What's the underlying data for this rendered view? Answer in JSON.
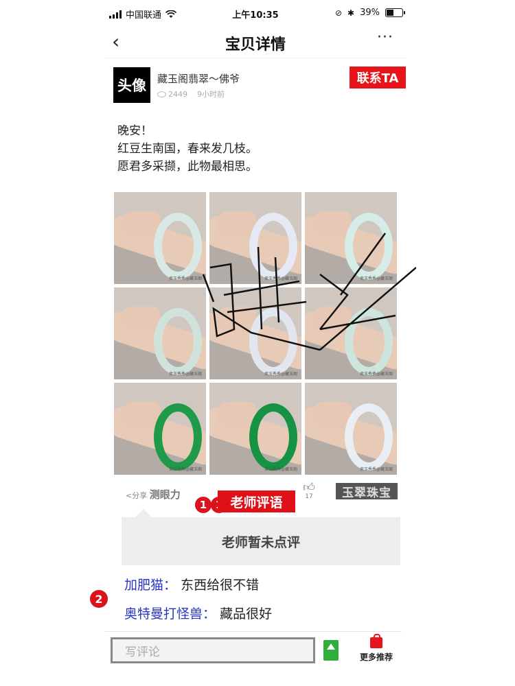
{
  "status": {
    "carrier": "中国联通",
    "time": "上午10:35",
    "battery": "39%"
  },
  "nav": {
    "back_icon": "‹",
    "title": "宝贝详情",
    "more_icon": "···"
  },
  "author": {
    "avatar_text": "头像",
    "name": "藏玉阁翡翠～佛爷",
    "views": "2449",
    "time_ago": "9小时前"
  },
  "contact_button": "联系TA",
  "post": {
    "lines": [
      "晚安！",
      "红豆生南国，春来发几枝。",
      "愿君多采撷，此物最相思。"
    ]
  },
  "photos": [
    {
      "watermark": "卖玉秀秀@藏玉阁",
      "bangle_color": "#d8e8e4"
    },
    {
      "watermark": "卖玉秀秀@藏玉阁",
      "bangle_color": "#e6e8f4"
    },
    {
      "watermark": "卖玉秀秀@藏玉阁",
      "bangle_color": "#d6ece6"
    },
    {
      "watermark": "卖玉秀秀@藏玉阁",
      "bangle_color": "#cfe3dc"
    },
    {
      "watermark": "卖玉秀秀@藏玉阁",
      "bangle_color": "#e1e6ef"
    },
    {
      "watermark": "卖玉秀秀@藏玉阁",
      "bangle_color": "#cde5dc"
    },
    {
      "watermark": "卖玉秀秀@藏玉阁",
      "bangle_color": "#1f9a4a"
    },
    {
      "watermark": "卖玉秀秀@藏玉阁",
      "bangle_color": "#159243"
    },
    {
      "watermark": "卖玉秀秀@藏玉阁",
      "bangle_color": "#e9eef4"
    }
  ],
  "actions": {
    "share_label": "分享",
    "test_label": "测眼力",
    "badge1": "1",
    "teacher_label": "老师评语",
    "like_count": "17",
    "brand_label": "玉翠珠宝"
  },
  "teacher_box": "老师暂未点评",
  "comments": [
    {
      "user": "加肥猫",
      "sep": "：",
      "text": "东西给很不错"
    },
    {
      "user": "奥特曼打怪兽",
      "sep": "：",
      "text": "藏品很好"
    }
  ],
  "badge2": "2",
  "bottom": {
    "input_placeholder": "写评论",
    "recommend_label": "更多推荐"
  },
  "colors": {
    "accent_red": "#e01018",
    "comment_user": "#2834c4",
    "share_green": "#2fae3a"
  }
}
